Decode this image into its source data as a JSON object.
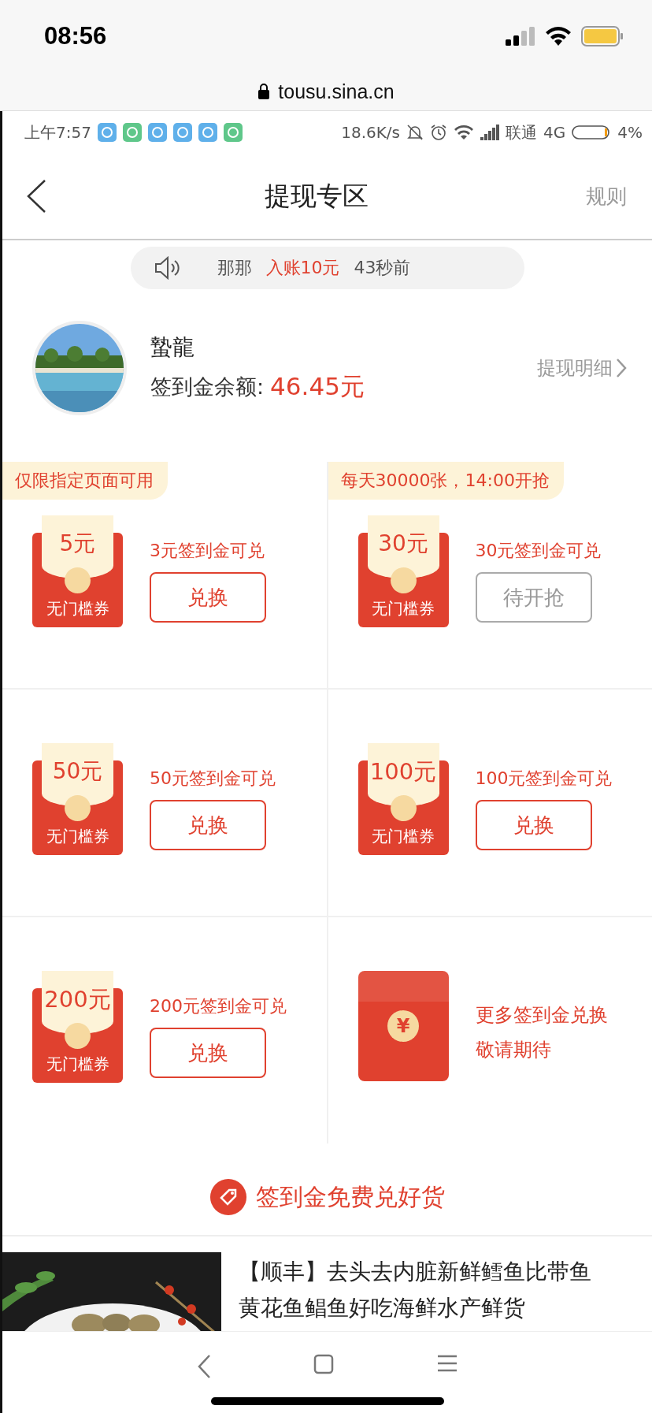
{
  "ios_status_bar": {
    "time": "08:56"
  },
  "browser": {
    "url": "tousu.sina.cn"
  },
  "android_status_bar": {
    "time": "上午7:57",
    "speed": "18.6K/s",
    "carrier": "联通",
    "network": "4G",
    "battery": "4%"
  },
  "header": {
    "title": "提现专区",
    "rules": "规则"
  },
  "notice": {
    "user": "那那",
    "action": "入账10元",
    "time": "43秒前"
  },
  "profile": {
    "name": "蟄龍",
    "balance_label": "签到金余额:",
    "balance": "46.45元",
    "details_link": "提现明细"
  },
  "coupons": [
    {
      "kind": "coupon",
      "tag": "仅限指定页面可用",
      "amount": "5元",
      "caption": "无门槛券",
      "condition": "3元签到金可兑",
      "button": {
        "label": "兑换",
        "disabled": false
      }
    },
    {
      "kind": "coupon",
      "tag": "每天30000张，14:00开抢",
      "amount": "30元",
      "caption": "无门槛券",
      "condition": "30元签到金可兑",
      "button": {
        "label": "待开抢",
        "disabled": true
      }
    },
    {
      "kind": "coupon",
      "amount": "50元",
      "caption": "无门槛券",
      "condition": "50元签到金可兑",
      "button": {
        "label": "兑换",
        "disabled": false
      }
    },
    {
      "kind": "coupon",
      "amount": "100元",
      "caption": "无门槛券",
      "condition": "100元签到金可兑",
      "button": {
        "label": "兑换",
        "disabled": false
      }
    },
    {
      "kind": "coupon",
      "amount": "200元",
      "caption": "无门槛券",
      "condition": "200元签到金可兑",
      "button": {
        "label": "兑换",
        "disabled": false
      }
    },
    {
      "kind": "more",
      "symbol": "¥",
      "lines": [
        "更多签到金兑换",
        "敬请期待"
      ]
    }
  ],
  "goods": {
    "title": "签到金免费兑好货",
    "items": [
      {
        "title": "【顺丰】去头去内脏新鲜鳕鱼比带鱼黄花鱼鲳鱼好吃海鲜水产鲜货"
      }
    ]
  }
}
